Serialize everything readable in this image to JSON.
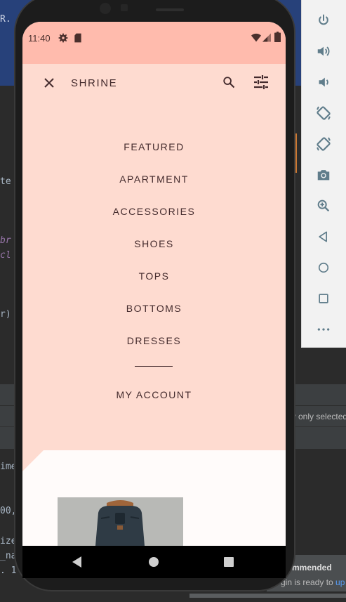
{
  "ide": {
    "top_text": "R.",
    "fragments": [
      "te",
      "br",
      "cl",
      "r)",
      "ime",
      "00,",
      "ize",
      "_na",
      ". 1"
    ],
    "view_only_label": "w only selected",
    "notification": {
      "title": "mmended",
      "body_prefix": "gin is ready to ",
      "body_link": "up"
    }
  },
  "emulator_toolbar": {
    "buttons": [
      "power-icon",
      "volume-up-icon",
      "volume-down-icon",
      "rotate-left-icon",
      "rotate-right-icon",
      "camera-icon",
      "zoom-icon",
      "back-icon",
      "home-icon",
      "overview-icon",
      "more-icon"
    ]
  },
  "status_bar": {
    "time": "11:40",
    "icons": [
      "settings-icon",
      "sd-card-icon",
      "wifi-icon",
      "signal-icon",
      "battery-icon"
    ]
  },
  "app_bar": {
    "title": "SHRINE",
    "icons": [
      "close-icon",
      "search-icon",
      "tune-icon"
    ]
  },
  "menu": {
    "items": [
      "FEATURED",
      "APARTMENT",
      "ACCESSORIES",
      "SHOES",
      "TOPS",
      "BOTTOMS",
      "DRESSES"
    ],
    "account": "MY ACCOUNT"
  },
  "colors": {
    "backdrop": "#fedbd0",
    "status_bar": "#ffbbad",
    "text": "#442b2d",
    "front_layer": "#fffbfa"
  }
}
